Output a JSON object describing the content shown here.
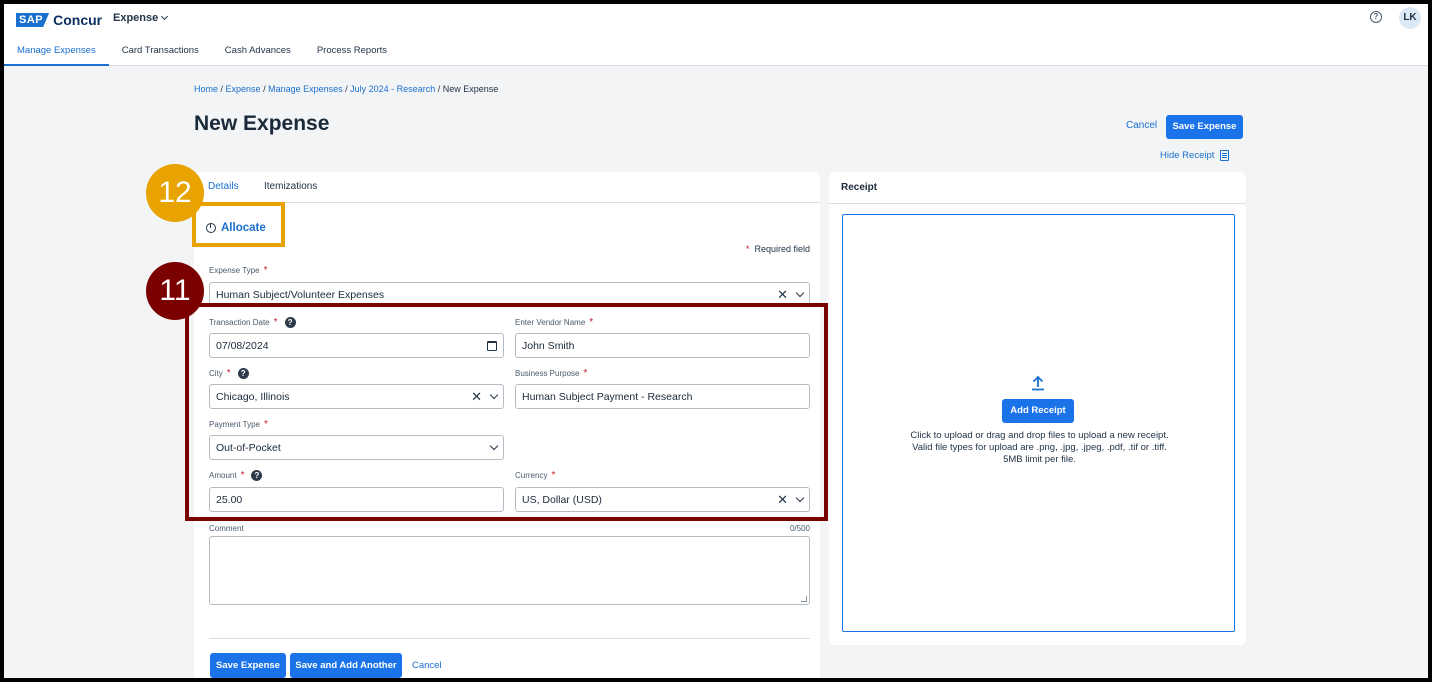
{
  "header": {
    "logo_sap": "SAP",
    "logo_concur": "Concur",
    "app_menu": "Expense",
    "help_icon": "?",
    "avatar": "LK"
  },
  "nav": [
    "Manage Expenses",
    "Card Transactions",
    "Cash Advances",
    "Process Reports"
  ],
  "breadcrumb": {
    "home": "Home",
    "expense": "Expense",
    "manage": "Manage Expenses",
    "report": "July 2024 - Research",
    "current": "New Expense",
    "sep": " / "
  },
  "page_title": "New Expense",
  "actions": {
    "cancel": "Cancel",
    "save": "Save Expense",
    "hide_receipt": "Hide Receipt"
  },
  "tabs": [
    "Details",
    "Itemizations"
  ],
  "allocate": "Allocate",
  "required_note": "Required field",
  "fields": {
    "expense_type": {
      "label": "Expense Type",
      "value": "Human Subject/Volunteer Expenses"
    },
    "transaction_date": {
      "label": "Transaction Date",
      "value": "07/08/2024"
    },
    "vendor": {
      "label": "Enter Vendor Name",
      "value": "John Smith"
    },
    "city": {
      "label": "City",
      "value": "Chicago, Illinois"
    },
    "purpose": {
      "label": "Business Purpose",
      "value": "Human Subject Payment - Research"
    },
    "payment_type": {
      "label": "Payment Type",
      "value": "Out-of-Pocket"
    },
    "amount": {
      "label": "Amount",
      "value": "25.00"
    },
    "currency": {
      "label": "Currency",
      "value": "US, Dollar (USD)"
    },
    "comment": {
      "label": "Comment",
      "counter": "0/500"
    }
  },
  "footer": {
    "save": "Save Expense",
    "save_add": "Save and Add Another",
    "cancel": "Cancel"
  },
  "receipt": {
    "title": "Receipt",
    "add": "Add Receipt",
    "line1": "Click to upload or drag and drop files to upload a new receipt.",
    "line2": "Valid file types for upload are .png, .jpg, .jpeg, .pdf, .tif or .tiff.",
    "line3": "5MB limit per file."
  },
  "callouts": {
    "a": "12",
    "b": "11"
  },
  "colors": {
    "accent": "#1a73e8",
    "callout_gold": "#e8a300",
    "callout_maroon": "#7b0000",
    "required": "#c21a2e"
  }
}
